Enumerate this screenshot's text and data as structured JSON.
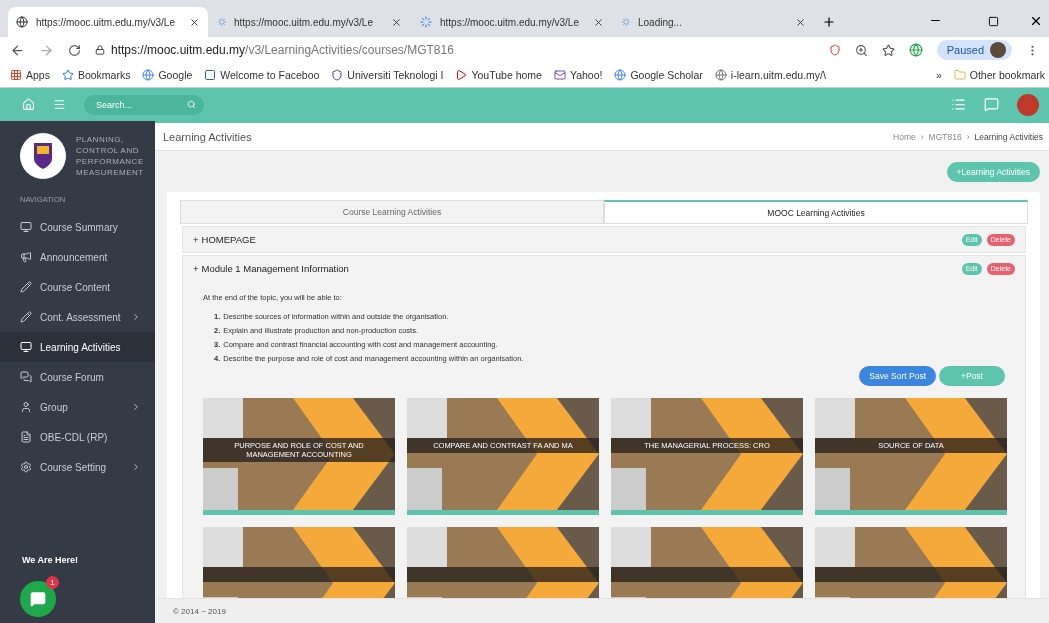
{
  "browser": {
    "tabs": [
      {
        "title": "https://mooc.uitm.edu.my/v3/Le",
        "kind": "site",
        "selected": true
      },
      {
        "title": "https://mooc.uitm.edu.my/v3/Le",
        "kind": "loading",
        "selected": false
      },
      {
        "title": "https://mooc.uitm.edu.my/v3/Le",
        "kind": "spinner",
        "selected": false
      },
      {
        "title": "Loading...",
        "kind": "loading",
        "selected": false
      }
    ],
    "url_host": "https://mooc.uitm.edu.my",
    "url_path": "/v3/LearningActivities/courses/MGT816",
    "profile": "Paused",
    "bookmarks": [
      {
        "label": "Apps",
        "kind": "apps"
      },
      {
        "label": "Bookmarks",
        "kind": "star"
      },
      {
        "label": "Google",
        "kind": "google"
      },
      {
        "label": "Welcome to Faceboo",
        "kind": "facebook"
      },
      {
        "label": "Universiti Teknologi I",
        "kind": "crest"
      },
      {
        "label": "YouTube home",
        "kind": "youtube"
      },
      {
        "label": "Yahoo!",
        "kind": "mail"
      },
      {
        "label": "Google Scholar",
        "kind": "scholar"
      },
      {
        "label": "i-learn.uitm.edu.my/\\",
        "kind": "site"
      }
    ],
    "overflow": "»",
    "other_bookmarks": "Other bookmark"
  },
  "header": {
    "search_placeholder": "Search..."
  },
  "sidebar": {
    "course": "PLANNING, CONTROL AND PERFORMANCE MEASUREMENT",
    "heading": "NAVIGATION",
    "items": [
      {
        "label": "Course Summary",
        "selected": false,
        "submenu": false
      },
      {
        "label": "Announcement",
        "selected": false,
        "submenu": false
      },
      {
        "label": "Course Content",
        "selected": false,
        "submenu": false
      },
      {
        "label": "Cont. Assessment",
        "selected": false,
        "submenu": true
      },
      {
        "label": "Learning Activities",
        "selected": true,
        "submenu": false
      },
      {
        "label": "Course Forum",
        "selected": false,
        "submenu": false
      },
      {
        "label": "Group",
        "selected": false,
        "submenu": true
      },
      {
        "label": "OBE-CDL (RP)",
        "selected": false,
        "submenu": false
      },
      {
        "label": "Course Setting",
        "selected": false,
        "submenu": true
      }
    ],
    "chat": {
      "label": "We Are Here!",
      "badge": "1"
    }
  },
  "page": {
    "title": "Learning Activities",
    "breadcrumbs": [
      "Home",
      "MGT816",
      "Learning Activities"
    ],
    "breadcrumb_separator": "›",
    "add_button": "+Learning Activities",
    "tabs": [
      {
        "label": "Course Learning Activities",
        "selected": false
      },
      {
        "label": "MOOC Learning Activities",
        "selected": true
      }
    ],
    "sections": [
      {
        "toggle": "+",
        "title": "HOMEPAGE",
        "expanded": false,
        "edit": "Edit",
        "delete": "Delete"
      },
      {
        "toggle": "+",
        "title": "Module 1 Management Information",
        "expanded": true,
        "edit": "Edit",
        "delete": "Delete"
      }
    ],
    "intro": "At the end of the topic, you will be able to:",
    "objectives": [
      {
        "number": "1.",
        "text": "Describe sources of information within and outside the organisation."
      },
      {
        "number": "2.",
        "text": "Explain and illustrate production and non-production costs."
      },
      {
        "number": "3.",
        "text": "Compare and contrast financial accounting with cost and management accounting."
      },
      {
        "number": "4.",
        "text": "Describe the purpose and role of cost and management accounting within an organisation."
      }
    ],
    "save_button": "Save Sort Post",
    "post_button": "+Post",
    "cards": [
      {
        "kind": "titled",
        "caption": "PURPOSE AND ROLE OF COST AND MANAGEMENT ACCOUNTING"
      },
      {
        "kind": "titled",
        "caption": "COMPARE AND CONTRAST FA AND MA"
      },
      {
        "kind": "titled",
        "caption": "THE MANAGERIAL PROCESS: CRO"
      },
      {
        "kind": "titled",
        "caption": "SOURCE OF DATA"
      },
      {
        "kind": "plain"
      },
      {
        "kind": "plain"
      },
      {
        "kind": "plain"
      },
      {
        "kind": "plain"
      }
    ]
  },
  "footer": "© 2014 ~ 2019"
}
